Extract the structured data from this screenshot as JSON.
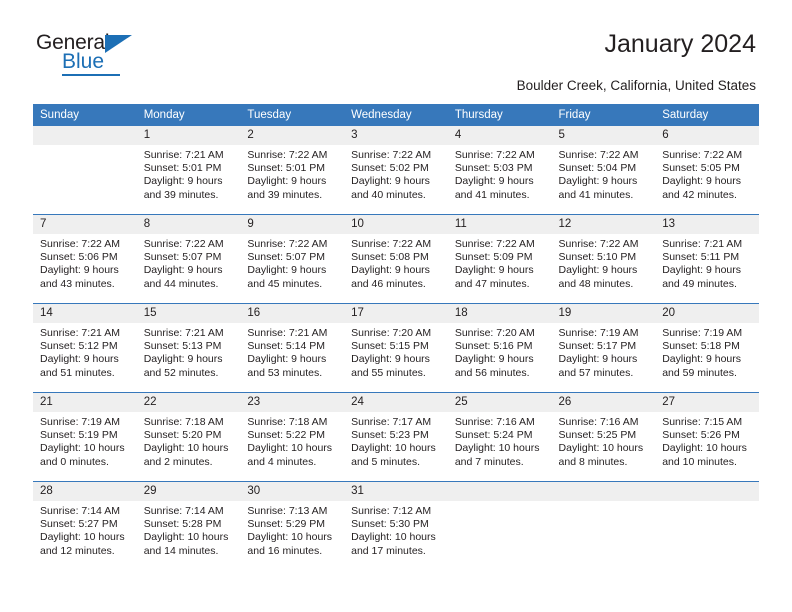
{
  "brand": {
    "name_dark": "General",
    "name_blue": "Blue",
    "accent_color": "#1c6fb5"
  },
  "header": {
    "title": "January 2024",
    "subtitle": "Boulder Creek, California, United States"
  },
  "colors": {
    "header_row_bg": "#3778bb",
    "daynum_bg": "#efefef",
    "text": "#231f20",
    "cell_bg": "#ffffff"
  },
  "weekday_headers": [
    "Sunday",
    "Monday",
    "Tuesday",
    "Wednesday",
    "Thursday",
    "Friday",
    "Saturday"
  ],
  "labels": {
    "sunrise_prefix": "Sunrise:",
    "sunset_prefix": "Sunset:",
    "daylight_prefix": "Daylight:"
  },
  "weeks": [
    [
      {
        "day": "",
        "empty": true,
        "line1": "",
        "line2": "",
        "line3": "",
        "line4": ""
      },
      {
        "day": "1",
        "line1": "Sunrise: 7:21 AM",
        "line2": "Sunset: 5:01 PM",
        "line3": "Daylight: 9 hours",
        "line4": "and 39 minutes."
      },
      {
        "day": "2",
        "line1": "Sunrise: 7:22 AM",
        "line2": "Sunset: 5:01 PM",
        "line3": "Daylight: 9 hours",
        "line4": "and 39 minutes."
      },
      {
        "day": "3",
        "line1": "Sunrise: 7:22 AM",
        "line2": "Sunset: 5:02 PM",
        "line3": "Daylight: 9 hours",
        "line4": "and 40 minutes."
      },
      {
        "day": "4",
        "line1": "Sunrise: 7:22 AM",
        "line2": "Sunset: 5:03 PM",
        "line3": "Daylight: 9 hours",
        "line4": "and 41 minutes."
      },
      {
        "day": "5",
        "line1": "Sunrise: 7:22 AM",
        "line2": "Sunset: 5:04 PM",
        "line3": "Daylight: 9 hours",
        "line4": "and 41 minutes."
      },
      {
        "day": "6",
        "line1": "Sunrise: 7:22 AM",
        "line2": "Sunset: 5:05 PM",
        "line3": "Daylight: 9 hours",
        "line4": "and 42 minutes."
      }
    ],
    [
      {
        "day": "7",
        "line1": "Sunrise: 7:22 AM",
        "line2": "Sunset: 5:06 PM",
        "line3": "Daylight: 9 hours",
        "line4": "and 43 minutes."
      },
      {
        "day": "8",
        "line1": "Sunrise: 7:22 AM",
        "line2": "Sunset: 5:07 PM",
        "line3": "Daylight: 9 hours",
        "line4": "and 44 minutes."
      },
      {
        "day": "9",
        "line1": "Sunrise: 7:22 AM",
        "line2": "Sunset: 5:07 PM",
        "line3": "Daylight: 9 hours",
        "line4": "and 45 minutes."
      },
      {
        "day": "10",
        "line1": "Sunrise: 7:22 AM",
        "line2": "Sunset: 5:08 PM",
        "line3": "Daylight: 9 hours",
        "line4": "and 46 minutes."
      },
      {
        "day": "11",
        "line1": "Sunrise: 7:22 AM",
        "line2": "Sunset: 5:09 PM",
        "line3": "Daylight: 9 hours",
        "line4": "and 47 minutes."
      },
      {
        "day": "12",
        "line1": "Sunrise: 7:22 AM",
        "line2": "Sunset: 5:10 PM",
        "line3": "Daylight: 9 hours",
        "line4": "and 48 minutes."
      },
      {
        "day": "13",
        "line1": "Sunrise: 7:21 AM",
        "line2": "Sunset: 5:11 PM",
        "line3": "Daylight: 9 hours",
        "line4": "and 49 minutes."
      }
    ],
    [
      {
        "day": "14",
        "line1": "Sunrise: 7:21 AM",
        "line2": "Sunset: 5:12 PM",
        "line3": "Daylight: 9 hours",
        "line4": "and 51 minutes."
      },
      {
        "day": "15",
        "line1": "Sunrise: 7:21 AM",
        "line2": "Sunset: 5:13 PM",
        "line3": "Daylight: 9 hours",
        "line4": "and 52 minutes."
      },
      {
        "day": "16",
        "line1": "Sunrise: 7:21 AM",
        "line2": "Sunset: 5:14 PM",
        "line3": "Daylight: 9 hours",
        "line4": "and 53 minutes."
      },
      {
        "day": "17",
        "line1": "Sunrise: 7:20 AM",
        "line2": "Sunset: 5:15 PM",
        "line3": "Daylight: 9 hours",
        "line4": "and 55 minutes."
      },
      {
        "day": "18",
        "line1": "Sunrise: 7:20 AM",
        "line2": "Sunset: 5:16 PM",
        "line3": "Daylight: 9 hours",
        "line4": "and 56 minutes."
      },
      {
        "day": "19",
        "line1": "Sunrise: 7:19 AM",
        "line2": "Sunset: 5:17 PM",
        "line3": "Daylight: 9 hours",
        "line4": "and 57 minutes."
      },
      {
        "day": "20",
        "line1": "Sunrise: 7:19 AM",
        "line2": "Sunset: 5:18 PM",
        "line3": "Daylight: 9 hours",
        "line4": "and 59 minutes."
      }
    ],
    [
      {
        "day": "21",
        "line1": "Sunrise: 7:19 AM",
        "line2": "Sunset: 5:19 PM",
        "line3": "Daylight: 10 hours",
        "line4": "and 0 minutes."
      },
      {
        "day": "22",
        "line1": "Sunrise: 7:18 AM",
        "line2": "Sunset: 5:20 PM",
        "line3": "Daylight: 10 hours",
        "line4": "and 2 minutes."
      },
      {
        "day": "23",
        "line1": "Sunrise: 7:18 AM",
        "line2": "Sunset: 5:22 PM",
        "line3": "Daylight: 10 hours",
        "line4": "and 4 minutes."
      },
      {
        "day": "24",
        "line1": "Sunrise: 7:17 AM",
        "line2": "Sunset: 5:23 PM",
        "line3": "Daylight: 10 hours",
        "line4": "and 5 minutes."
      },
      {
        "day": "25",
        "line1": "Sunrise: 7:16 AM",
        "line2": "Sunset: 5:24 PM",
        "line3": "Daylight: 10 hours",
        "line4": "and 7 minutes."
      },
      {
        "day": "26",
        "line1": "Sunrise: 7:16 AM",
        "line2": "Sunset: 5:25 PM",
        "line3": "Daylight: 10 hours",
        "line4": "and 8 minutes."
      },
      {
        "day": "27",
        "line1": "Sunrise: 7:15 AM",
        "line2": "Sunset: 5:26 PM",
        "line3": "Daylight: 10 hours",
        "line4": "and 10 minutes."
      }
    ],
    [
      {
        "day": "28",
        "line1": "Sunrise: 7:14 AM",
        "line2": "Sunset: 5:27 PM",
        "line3": "Daylight: 10 hours",
        "line4": "and 12 minutes."
      },
      {
        "day": "29",
        "line1": "Sunrise: 7:14 AM",
        "line2": "Sunset: 5:28 PM",
        "line3": "Daylight: 10 hours",
        "line4": "and 14 minutes."
      },
      {
        "day": "30",
        "line1": "Sunrise: 7:13 AM",
        "line2": "Sunset: 5:29 PM",
        "line3": "Daylight: 10 hours",
        "line4": "and 16 minutes."
      },
      {
        "day": "31",
        "line1": "Sunrise: 7:12 AM",
        "line2": "Sunset: 5:30 PM",
        "line3": "Daylight: 10 hours",
        "line4": "and 17 minutes."
      },
      {
        "day": "",
        "empty": true,
        "line1": "",
        "line2": "",
        "line3": "",
        "line4": ""
      },
      {
        "day": "",
        "empty": true,
        "line1": "",
        "line2": "",
        "line3": "",
        "line4": ""
      },
      {
        "day": "",
        "empty": true,
        "line1": "",
        "line2": "",
        "line3": "",
        "line4": ""
      }
    ]
  ]
}
